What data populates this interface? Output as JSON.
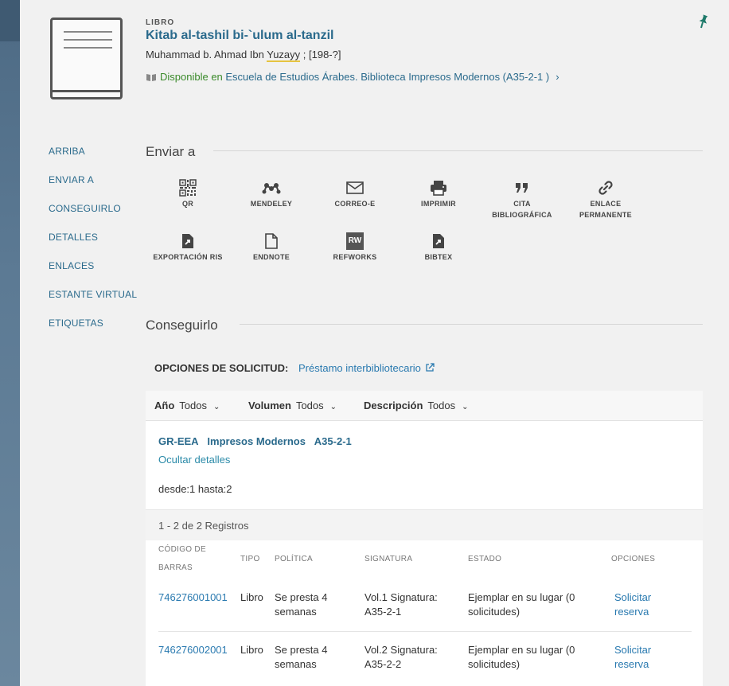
{
  "record": {
    "type": "LIBRO",
    "title": "Kitab al-tashil bi-`ulum al-tanzil",
    "author_pre": "Muhammad b. Ahmad Ibn ",
    "author_underlined": "Yuzayy",
    "author_post": " ; [198-?]",
    "available": "Disponible",
    "available_in": " en ",
    "location": "Escuela de Estudios Árabes. Biblioteca  Impresos Modernos (A35-2-1 )"
  },
  "side_nav": [
    "ARRIBA",
    "ENVIAR A",
    "CONSEGUIRLO",
    "DETALLES",
    "ENLACES",
    "ESTANTE VIRTUAL",
    "ETIQUETAS"
  ],
  "send_to": {
    "title": "Enviar a",
    "items": [
      {
        "label": "QR",
        "icon": "qr-icon"
      },
      {
        "label": "MENDELEY",
        "icon": "mendeley-icon"
      },
      {
        "label": "CORREO-E",
        "icon": "mail-icon"
      },
      {
        "label": "IMPRIMIR",
        "icon": "printer-icon"
      },
      {
        "label": "CITA BIBLIOGRÁFICA",
        "icon": "quote-icon"
      },
      {
        "label": "ENLACE PERMANENTE",
        "icon": "link-icon"
      },
      {
        "label": "EXPORTACIÓN RIS",
        "icon": "export-file-icon"
      },
      {
        "label": "ENDNOTE",
        "icon": "file-icon"
      },
      {
        "label": "REFWORKS",
        "icon": "refworks-icon",
        "icon_text": "RW"
      },
      {
        "label": "BIBTEX",
        "icon": "export-file-icon"
      }
    ]
  },
  "get_it": {
    "title": "Conseguirlo",
    "request_options_label": "OPCIONES DE SOLICITUD:",
    "request_link": "Préstamo interbibliotecario",
    "filters": [
      {
        "label": "Año",
        "value": "Todos"
      },
      {
        "label": "Volumen",
        "value": "Todos"
      },
      {
        "label": "Descripción",
        "value": "Todos"
      }
    ],
    "holding": {
      "code": "GR-EEA",
      "collection": "Impresos Modernos",
      "callnum": "A35-2-1",
      "hide_details": "Ocultar detalles",
      "range": "desde:1 hasta:2"
    },
    "count": "1 - 2 de 2 Registros",
    "columns": {
      "barcode_1": "CÓDIGO DE",
      "barcode_2": "BARRAS",
      "type": "TIPO",
      "policy": "POLÍTICA",
      "callnumber": "SIGNATURA",
      "status": "ESTADO",
      "options": "OPCIONES"
    },
    "rows": [
      {
        "barcode": "746276001001",
        "type": "Libro",
        "policy": "Se presta 4 semanas",
        "callnumber": "Vol.1  Signatura: A35-2-1",
        "status": "Ejemplar en su lugar (0 solicitudes)",
        "option": "Solicitar reserva"
      },
      {
        "barcode": "746276002001",
        "type": "Libro",
        "policy": "Se presta 4 semanas",
        "callnumber": "Vol.2  Signatura: A35-2-2",
        "status": "Ejemplar en su lugar (0 solicitudes)",
        "option": "Solicitar reserva"
      }
    ]
  },
  "colors": {
    "link": "#2a6a8c",
    "available": "#3a8a2a",
    "pin": "#1e7a6a"
  }
}
